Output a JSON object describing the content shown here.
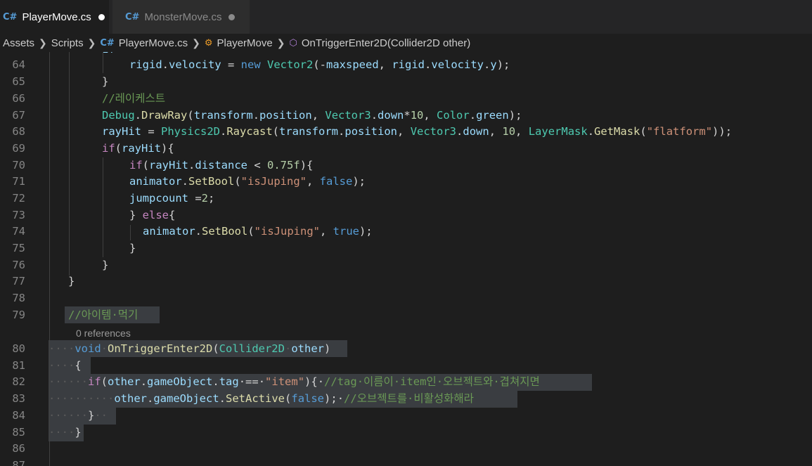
{
  "tabs": [
    {
      "label": "PlayerMove.cs",
      "icon": "csharp-file-icon",
      "active": true,
      "modified": true
    },
    {
      "label": "MonsterMove.cs",
      "icon": "csharp-file-icon",
      "active": false,
      "modified": true
    }
  ],
  "breadcrumb": {
    "assets": "Assets",
    "scripts": "Scripts",
    "file": "PlayerMove.cs",
    "class": "PlayerMove",
    "method": "OnTriggerEnter2D(Collider2D other)"
  },
  "editor": {
    "code_lens": "0 references",
    "line_numbers": [
      "64",
      "65",
      "66",
      "67",
      "68",
      "69",
      "70",
      "71",
      "72",
      "73",
      "74",
      "75",
      "76",
      "77",
      "78",
      "79",
      "80",
      "81",
      "82",
      "83",
      "84",
      "85",
      "86",
      "87"
    ],
    "lines": {
      "l64": [
        "rigid",
        ".",
        "velocity",
        " = ",
        "new",
        " ",
        "Vector2",
        "(-",
        "maxspeed",
        ", ",
        "rigid",
        ".",
        "velocity",
        ".",
        "y",
        ");"
      ],
      "l65": "}",
      "l66": "//레이케스트",
      "l67": [
        "Debug",
        ".",
        "DrawRay",
        "(",
        "transform",
        ".",
        "position",
        ", ",
        "Vector3",
        ".",
        "down",
        "*",
        "10",
        ", ",
        "Color",
        ".",
        "green",
        ");"
      ],
      "l68": [
        "rayHit",
        " = ",
        "Physics2D",
        ".",
        "Raycast",
        "(",
        "transform",
        ".",
        "position",
        ", ",
        "Vector3",
        ".",
        "down",
        ", ",
        "10",
        ", ",
        "LayerMask",
        ".",
        "GetMask",
        "(",
        "\"flatform\"",
        "));"
      ],
      "l69": [
        "if",
        "(",
        "rayHit",
        "){"
      ],
      "l70": [
        "if",
        "(",
        "rayHit",
        ".",
        "distance",
        " < ",
        "0.75f",
        "){"
      ],
      "l71": [
        "animator",
        ".",
        "SetBool",
        "(",
        "\"isJuping\"",
        ", ",
        "false",
        ");"
      ],
      "l72": [
        "jumpcount",
        " =",
        "2",
        ";"
      ],
      "l73": [
        "} ",
        "else",
        "{"
      ],
      "l74": [
        "animator",
        ".",
        "SetBool",
        "(",
        "\"isJuping\"",
        ", ",
        "true",
        ");"
      ],
      "l75": "}",
      "l76": "}",
      "l77": "}",
      "l79": "//아이템·먹기",
      "l80": [
        "····",
        "void",
        "·",
        "OnTriggerEnter2D",
        "(",
        "Collider2D",
        "·",
        "other",
        ")"
      ],
      "l81": [
        "····",
        "{"
      ],
      "l82": [
        "······",
        "if",
        "(",
        "other",
        ".",
        "gameObject",
        ".",
        "tag",
        "·==·",
        "\"item\"",
        "){·",
        "//tag·이름이·item인·오브젝트와·겹쳐지면"
      ],
      "l83": [
        "··········",
        "other",
        ".",
        "gameObject",
        ".",
        "SetActive",
        "(",
        "false",
        ");·",
        "//오브젝트를·비활성화해라"
      ],
      "l84": [
        "······",
        "}",
        "··"
      ],
      "l85": [
        "····",
        "}"
      ]
    }
  }
}
